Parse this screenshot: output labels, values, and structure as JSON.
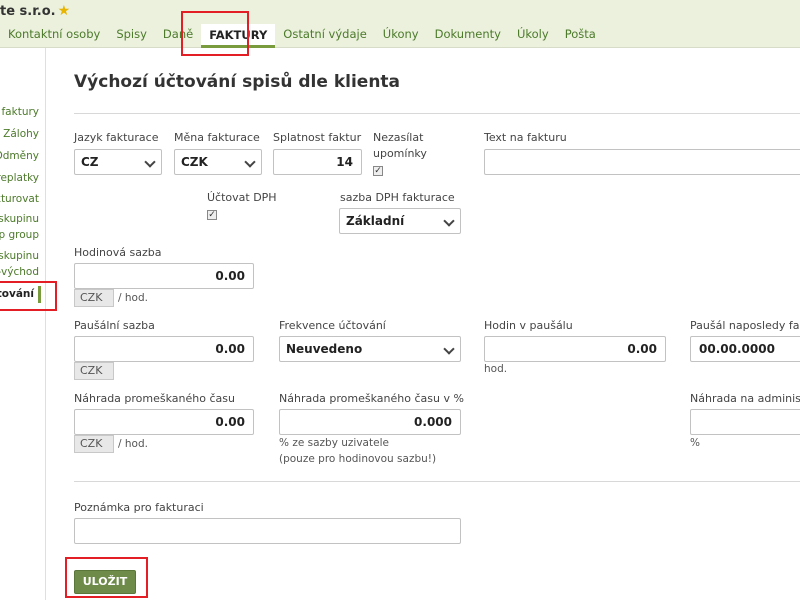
{
  "header": {
    "company": "te s.r.o.",
    "star_icon": "star-icon"
  },
  "nav": {
    "items": [
      "Kontaktní osoby",
      "Spisy",
      "Daně",
      "FAKTURY",
      "Ostatní výdaje",
      "Úkony",
      "Dokumenty",
      "Úkoly",
      "Pošta"
    ],
    "active": "FAKTURY"
  },
  "sidebar": {
    "items": [
      "faktury",
      "Zálohy",
      "Odměny",
      "replatky",
      "kturovat",
      "skupinu",
      "p group",
      "skupinu",
      "-východ",
      "účtování"
    ]
  },
  "page": {
    "title": "Výchozí účtování spisů dle klienta"
  },
  "form": {
    "jazyk_label": "Jazyk fakturace",
    "jazyk_value": "CZ",
    "mena_label": "Měna fakturace",
    "mena_value": "CZK",
    "splatnost_label": "Splatnost faktur",
    "splatnost_value": "14",
    "nezasilat_label_1": "Nezasílat",
    "nezasilat_label_2": "upomínky",
    "text_label": "Text na fakturu",
    "text_value": "",
    "uctovat_dph_label": "Účtovat DPH",
    "sazba_dph_label": "sazba DPH fakturace",
    "sazba_dph_value": "Základní",
    "hodinova_label": "Hodinová sazba",
    "hodinova_value": "0.00",
    "hodinova_currency": "CZK",
    "per_hour": "/ hod.",
    "pausalni_label": "Paušální sazba",
    "pausalni_value": "0.00",
    "pausalni_currency": "CZK",
    "frekvence_label": "Frekvence účtování",
    "frekvence_value": "Neuvedeno",
    "hodin_label": "Hodin v paušálu",
    "hodin_value": "0.00",
    "hodin_unit": "hod.",
    "pausal_naposledy_label": "Paušál naposledy fakt",
    "pausal_naposledy_value": "00.00.0000",
    "nahrada_label": "Náhrada promeškaného času",
    "nahrada_value": "0.00",
    "nahrada_currency": "CZK",
    "nahrada_per_hour": "/ hod.",
    "nahrada_pct_label": "Náhrada promeškaného času v %",
    "nahrada_pct_value": "0.000",
    "nahrada_pct_hint_1": "% ze sazby uzivatele",
    "nahrada_pct_hint_2": "(pouze pro hodinovou sazbu!)",
    "nahrada_admin_label": "Náhrada na administr",
    "nahrada_admin_unit": "%",
    "poznamka_label": "Poznámka pro fakturaci",
    "poznamka_value": "",
    "checkbox_mark": "✓"
  },
  "buttons": {
    "save": "ULOŽIT"
  }
}
